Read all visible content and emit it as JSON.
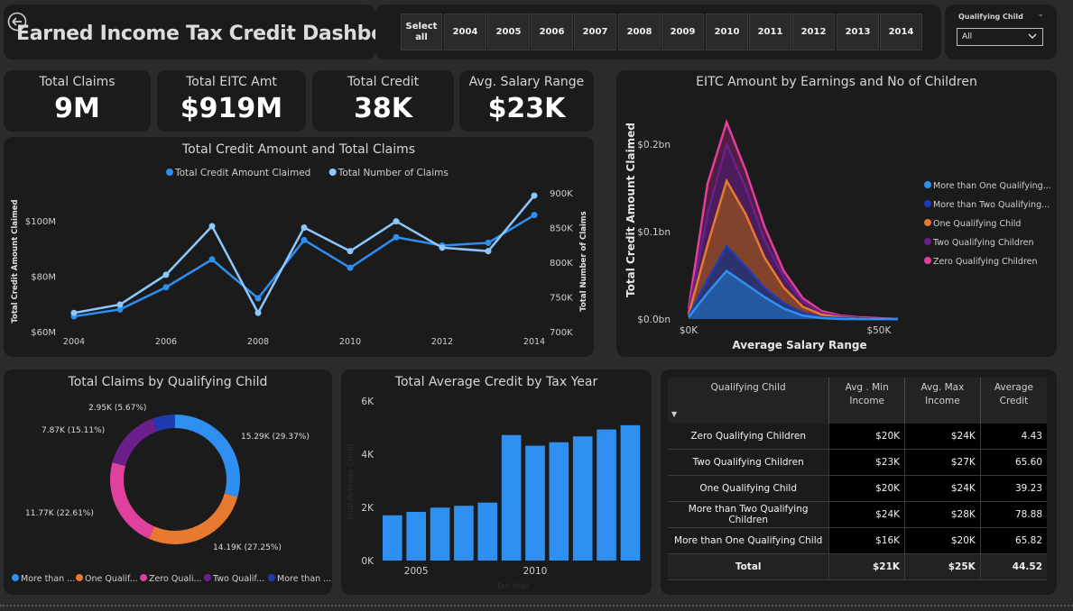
{
  "header": {
    "title": "Earned Income Tax Credit Dashboard",
    "back_icon": "arrow-left-circle-icon"
  },
  "year_slicer": {
    "select_all": "Select all",
    "years": [
      "2004",
      "2005",
      "2006",
      "2007",
      "2008",
      "2009",
      "2010",
      "2011",
      "2012",
      "2013",
      "2014"
    ]
  },
  "qualifying_child_filter": {
    "label": "Qualifying Child",
    "value": "All"
  },
  "kpis": [
    {
      "label": "Total Claims",
      "value": "9M"
    },
    {
      "label": "Total EITC Amt",
      "value": "$919M"
    },
    {
      "label": "Total Credit",
      "value": "38K"
    },
    {
      "label": "Avg. Salary Range",
      "value": "$23K"
    }
  ],
  "colors": {
    "panel_bg": "#1b1b1b",
    "page_bg": "#2b2b2b",
    "blue": "#2f8ff0",
    "light_blue": "#8cc8ff",
    "navy": "#1f3bb3",
    "orange": "#e87930",
    "purple": "#6a1f8c",
    "pink": "#e0409e",
    "bar_blue": "#2f8ff0"
  },
  "chart_data": [
    {
      "type": "line",
      "title": "Total Credit Amount and Total Claims",
      "x": [
        2004,
        2005,
        2006,
        2007,
        2008,
        2009,
        2010,
        2011,
        2012,
        2013,
        2014
      ],
      "x_ticks": [
        "2004",
        "2006",
        "2008",
        "2010",
        "2012",
        "2014"
      ],
      "ylabel": "Total Credit Amount Claimed",
      "y2label": "Total Number of Claims",
      "y_ticks": [
        "$60M",
        "$80M",
        "$100M"
      ],
      "y2_ticks": [
        "700K",
        "750K",
        "800K",
        "850K",
        "900K"
      ],
      "ylim": [
        60,
        110
      ],
      "y2lim": [
        700,
        900
      ],
      "series": [
        {
          "name": "Total Credit Amount Claimed",
          "axis": "left",
          "values": [
            65.5,
            68,
            76,
            86,
            72,
            93,
            83,
            94,
            91,
            92,
            102
          ]
        },
        {
          "name": "Total Number of Claims",
          "axis": "right",
          "values": [
            727,
            739,
            782,
            852,
            727,
            850,
            816,
            859,
            821,
            816,
            896
          ]
        }
      ]
    },
    {
      "type": "area",
      "title": "EITC Amount by Earnings and No of Children",
      "xlabel": "Average Salary Range",
      "ylabel": "Total Credit Amount Claimed",
      "x_ticks": [
        "$0K",
        "$50K"
      ],
      "y_ticks": [
        "$0.0bn",
        "$0.1bn",
        "$0.2bn"
      ],
      "x": [
        0,
        5,
        10,
        15,
        20,
        25,
        30,
        35,
        40,
        45,
        50,
        55
      ],
      "ylim": [
        0,
        0.2
      ],
      "series": [
        {
          "name": "More than One Qualifying...",
          "values": [
            0.002,
            0.03,
            0.055,
            0.04,
            0.025,
            0.012,
            0.004,
            0.001,
            0,
            0,
            0,
            0
          ]
        },
        {
          "name": "More than Two Qualifying...",
          "values": [
            0.003,
            0.045,
            0.083,
            0.06,
            0.035,
            0.018,
            0.007,
            0.002,
            0.001,
            0,
            0,
            0
          ]
        },
        {
          "name": "One Qualifying Child",
          "values": [
            0.005,
            0.085,
            0.158,
            0.12,
            0.07,
            0.036,
            0.014,
            0.005,
            0.002,
            0,
            0,
            0
          ]
        },
        {
          "name": "Two Qualifying Children",
          "values": [
            0.008,
            0.12,
            0.2,
            0.15,
            0.09,
            0.048,
            0.02,
            0.007,
            0.003,
            0.001,
            0,
            0
          ]
        },
        {
          "name": "Zero Qualifying Children",
          "values": [
            0.012,
            0.155,
            0.225,
            0.17,
            0.105,
            0.055,
            0.024,
            0.009,
            0.004,
            0.002,
            0.001,
            0
          ]
        }
      ]
    },
    {
      "type": "pie",
      "title": "Total Claims by Qualifying Child",
      "slices": [
        {
          "name": "More than One Qualifying Child",
          "legend": "More than ...",
          "value": 15.29,
          "label": "15.29K (29.37%)"
        },
        {
          "name": "One Qualifying Child",
          "legend": "One Qualif...",
          "value": 14.19,
          "label": "14.19K (27.25%)"
        },
        {
          "name": "Zero Qualifying Children",
          "legend": "Zero Quali...",
          "value": 11.77,
          "label": "11.77K (22.61%)"
        },
        {
          "name": "Two Qualifying Children",
          "legend": "Two Qualif...",
          "value": 7.87,
          "label": "7.87K (15.11%)"
        },
        {
          "name": "More than Two Qualifying Children",
          "legend": "More than ...",
          "value": 2.95,
          "label": "2.95K (5.67%)"
        }
      ]
    },
    {
      "type": "bar",
      "title": "Total Average Credit by Tax Year",
      "xlabel": "Tax Year",
      "ylabel": "Total Average Credit",
      "categories": [
        "2004",
        "2005",
        "2006",
        "2007",
        "2008",
        "2009",
        "2010",
        "2011",
        "2012",
        "2013",
        "2014"
      ],
      "x_ticks": [
        "2005",
        "2010"
      ],
      "y_ticks": [
        "0K",
        "2K",
        "4K",
        "6K"
      ],
      "values": [
        1700,
        1830,
        1990,
        2060,
        2180,
        4720,
        4320,
        4450,
        4670,
        4930,
        5090
      ],
      "ylim": [
        0,
        6000
      ]
    }
  ],
  "table": {
    "headers": [
      "Qualifying Child",
      "Avg . Min Income",
      "Avg. Max Income",
      "Average Credit"
    ],
    "rows": [
      [
        "Zero Qualifying Children",
        "$20K",
        "$24K",
        "4.43"
      ],
      [
        "Two Qualifying Children",
        "$23K",
        "$27K",
        "65.60"
      ],
      [
        "One Qualifying Child",
        "$20K",
        "$24K",
        "39.23"
      ],
      [
        "More than Two Qualifying Children",
        "$24K",
        "$28K",
        "78.88"
      ],
      [
        "More than One Qualifying Child",
        "$16K",
        "$20K",
        "65.82"
      ]
    ],
    "total": [
      "Total",
      "$21K",
      "$25K",
      "44.52"
    ]
  }
}
